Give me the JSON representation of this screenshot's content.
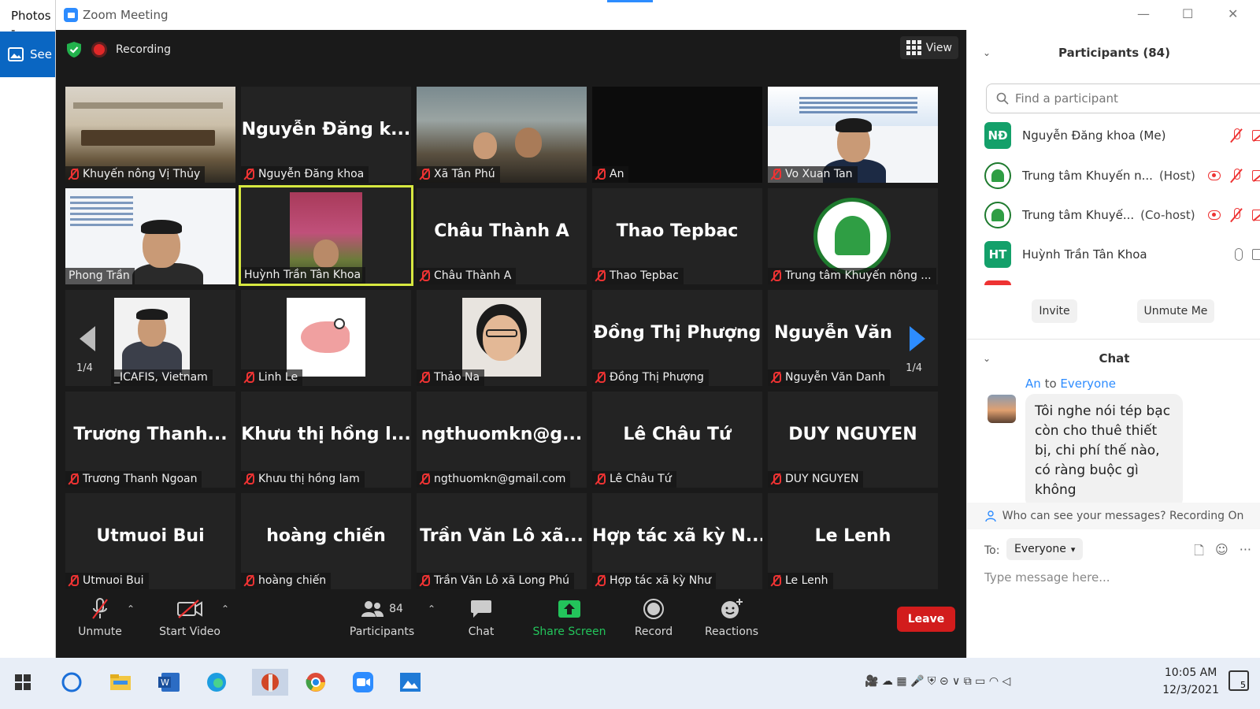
{
  "background_app": {
    "title": "Photos -",
    "see_label": "See"
  },
  "window": {
    "title": "Zoom Meeting",
    "minimize": "—",
    "maximize": "☐",
    "close": "✕"
  },
  "meeting": {
    "recording_label": "Recording",
    "view_label": "View",
    "page_left": "1/4",
    "page_right": "1/4",
    "tiles": [
      {
        "big": "",
        "name": "Khuyến nông Vị Thủy"
      },
      {
        "big": "Nguyễn Đăng k...",
        "name": "Nguyễn Đăng khoa"
      },
      {
        "big": "",
        "name": "Xã Tân Phú"
      },
      {
        "big": "",
        "name": "An"
      },
      {
        "big": "",
        "name": "Vo Xuan Tan"
      },
      {
        "big": "",
        "name": "Phong Trần"
      },
      {
        "big": "",
        "name": "Huỳnh Trần Tân Khoa"
      },
      {
        "big": "Châu Thành A",
        "name": "Châu Thành A"
      },
      {
        "big": "Thao Tepbac",
        "name": "Thao Tepbac"
      },
      {
        "big": "",
        "name": "Trung tâm Khuyến nông ..."
      },
      {
        "big": "",
        "name": "_ICAFIS, Vietnam"
      },
      {
        "big": "",
        "name": "Linh Le"
      },
      {
        "big": "",
        "name": "Thảo Na"
      },
      {
        "big": "Đồng Thị Phượng",
        "name": "Đồng Thị Phượng"
      },
      {
        "big": "Nguyễn Văn",
        "name": "Nguyễn Văn Danh"
      },
      {
        "big": "Trương Thanh...",
        "name": "Trương Thanh Ngoan"
      },
      {
        "big": "Khưu thị hồng l...",
        "name": "Khưu thị hồng lam"
      },
      {
        "big": "ngthuomkn@g...",
        "name": "ngthuomkn@gmail.com"
      },
      {
        "big": "Lê Châu Tứ",
        "name": "Lê Châu Tứ"
      },
      {
        "big": "DUY NGUYEN",
        "name": "DUY NGUYEN"
      },
      {
        "big": "Utmuoi Bui",
        "name": "Utmuoi Bui"
      },
      {
        "big": "hoàng chiến",
        "name": "hoàng chiến"
      },
      {
        "big": "Trần Văn Lô xã...",
        "name": "Trần Văn Lô xã Long Phú"
      },
      {
        "big": "Hợp tác xã kỳ N...",
        "name": "Hợp tác xã kỳ Như"
      },
      {
        "big": "Le Lenh",
        "name": "Le Lenh"
      }
    ],
    "toolbar": {
      "unmute": "Unmute",
      "start_video": "Start Video",
      "participants": "Participants",
      "participants_count": "84",
      "chat": "Chat",
      "share_screen": "Share Screen",
      "record": "Record",
      "reactions": "Reactions",
      "leave": "Leave"
    }
  },
  "participants_panel": {
    "title": "Participants (84)",
    "search_placeholder": "Find a participant",
    "rows": [
      {
        "initials": "NĐ",
        "color": "#14a06a",
        "name": "Nguyễn Đăng khoa (Me)",
        "role": ""
      },
      {
        "initials": "",
        "color": "#ffffff",
        "name": "Trung tâm Khuyến n...",
        "role": "(Host)"
      },
      {
        "initials": "",
        "color": "#ffffff",
        "name": "Trung tâm Khuyế...",
        "role": "(Co-host)"
      },
      {
        "initials": "HT",
        "color": "#14a06a",
        "name": "Huỳnh Trần Tân Khoa",
        "role": ""
      }
    ],
    "invite": "Invite",
    "unmute_me": "Unmute Me"
  },
  "chat_panel": {
    "title": "Chat",
    "from": "An",
    "to_word": "to",
    "to_target": "Everyone",
    "message": "Tôi nghe nói tép bạc còn cho thuê thiết bị, chi phí thế nào, có ràng buộc gì không",
    "who_can_see": "Who can see your messages? Recording On",
    "to_label": "To:",
    "recipient": "Everyone",
    "input_placeholder": "Type message here..."
  },
  "taskbar": {
    "time": "10:05 AM",
    "date": "12/3/2021",
    "notifications": "5"
  }
}
